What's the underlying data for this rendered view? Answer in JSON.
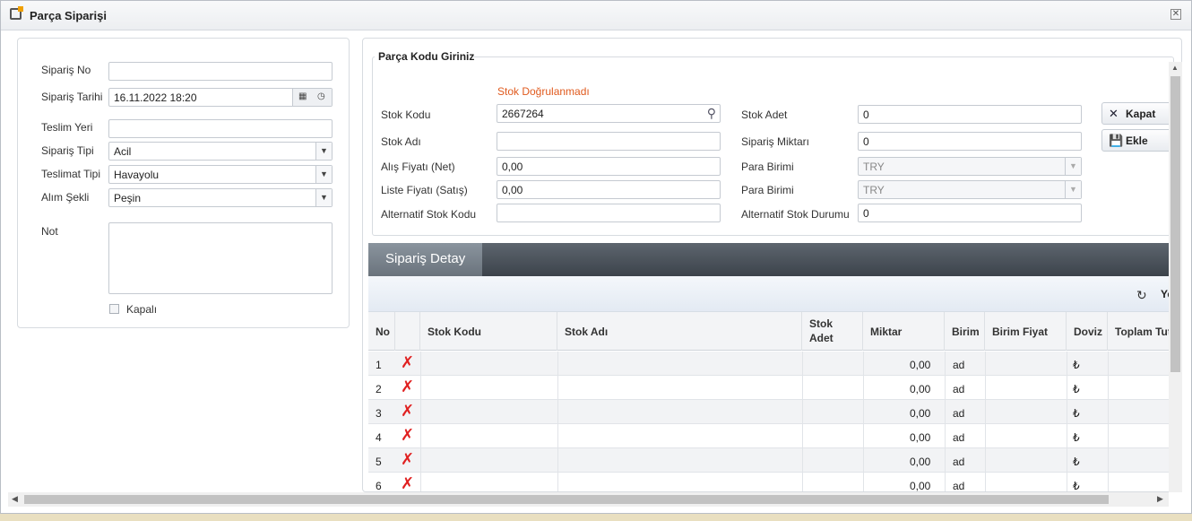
{
  "window": {
    "title": "Parça Siparişi",
    "close_icon": "close-icon"
  },
  "order_form": {
    "siparis_no": {
      "label": "Sipariş No",
      "value": ""
    },
    "siparis_tarihi": {
      "label": "Sipariş Tarihi",
      "value": "16.11.2022 18:20"
    },
    "teslim_yeri": {
      "label": "Teslim Yeri",
      "value": ""
    },
    "siparis_tipi": {
      "label": "Sipariş Tipi",
      "value": "Acil"
    },
    "teslimat_tipi": {
      "label": "Teslimat Tipi",
      "value": "Havayolu"
    },
    "alim_sekli": {
      "label": "Alım Şekli",
      "value": "Peşin"
    },
    "not": {
      "label": "Not",
      "value": ""
    },
    "kapali": {
      "label": "Kapalı",
      "checked": false
    }
  },
  "part_entry": {
    "title": "Parça Kodu Giriniz",
    "warning": "Stok Doğrulanmadı",
    "stok_kodu": {
      "label": "Stok Kodu",
      "value": "2667264"
    },
    "stok_adi": {
      "label": "Stok Adı",
      "value": ""
    },
    "alis_fiyati": {
      "label": "Alış Fiyatı (Net)",
      "value": "0,00"
    },
    "liste_fiyati": {
      "label": "Liste Fiyatı (Satış)",
      "value": "0,00"
    },
    "alternatif_stok_kodu": {
      "label": "Alternatif Stok Kodu",
      "value": ""
    },
    "stok_adet": {
      "label": "Stok Adet",
      "value": "0"
    },
    "siparis_miktari": {
      "label": "Sipariş Miktarı",
      "value": "0"
    },
    "para_birimi_1": {
      "label": "Para Birimi",
      "value": "TRY"
    },
    "para_birimi_2": {
      "label": "Para Birimi",
      "value": "TRY"
    },
    "alternatif_stok_durumu": {
      "label": "Alternatif Stok Durumu",
      "value": "0"
    },
    "kapat_button": "Kapat",
    "ekle_button": "Ekle"
  },
  "grid": {
    "tab_title": "Sipariş Detay",
    "refresh_label": "Ye",
    "columns": {
      "no": "No",
      "stok_kodu": "Stok Kodu",
      "stok_adi": "Stok Adı",
      "stok_adet_1": "Stok",
      "stok_adet_2": "Adet",
      "miktar": "Miktar",
      "birim": "Birim",
      "birim_fiyat": "Birim Fiyat",
      "doviz": "Doviz",
      "toplam": "Toplam Tut"
    },
    "rows": [
      {
        "no": "1",
        "miktar": "0,00",
        "birim": "ad",
        "doviz": "₺"
      },
      {
        "no": "2",
        "miktar": "0,00",
        "birim": "ad",
        "doviz": "₺"
      },
      {
        "no": "3",
        "miktar": "0,00",
        "birim": "ad",
        "doviz": "₺"
      },
      {
        "no": "4",
        "miktar": "0,00",
        "birim": "ad",
        "doviz": "₺"
      },
      {
        "no": "5",
        "miktar": "0,00",
        "birim": "ad",
        "doviz": "₺"
      },
      {
        "no": "6",
        "miktar": "0,00",
        "birim": "ad",
        "doviz": "₺"
      }
    ]
  }
}
